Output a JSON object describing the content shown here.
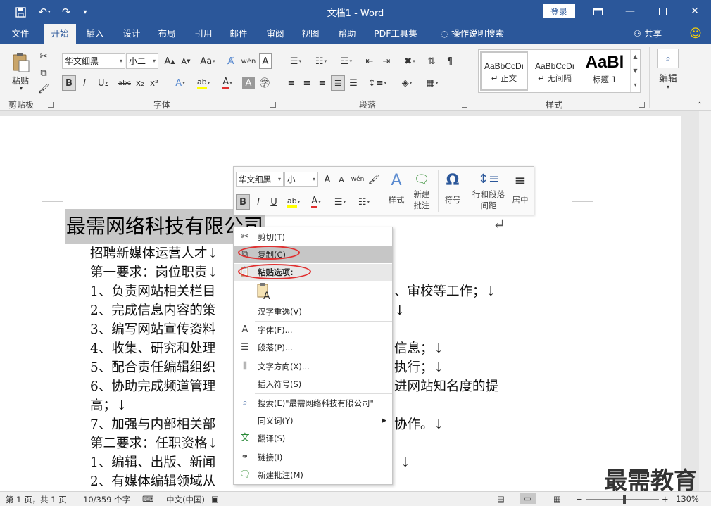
{
  "titlebar": {
    "title": "文档1 - Word",
    "login_label": "登录"
  },
  "menu": {
    "tabs": [
      "文件",
      "开始",
      "插入",
      "设计",
      "布局",
      "引用",
      "邮件",
      "审阅",
      "视图",
      "帮助",
      "PDF工具集"
    ],
    "tell_me": "操作说明搜索",
    "share": "共享"
  },
  "ribbon": {
    "font_name": "华文细黑",
    "font_size": "小二",
    "groups": {
      "clipboard": "剪贴板",
      "font": "字体",
      "paragraph": "段落",
      "styles": "样式",
      "editing": "编辑"
    },
    "paste_label": "粘贴",
    "styles": [
      {
        "preview": "AaBbCcDı",
        "name": "↵ 正文"
      },
      {
        "preview": "AaBbCcDı",
        "name": "↵ 无间隔"
      },
      {
        "preview": "AaBl",
        "name": "标题 1"
      }
    ],
    "editing_label": "编辑"
  },
  "document": {
    "title": "最需网络科技有限公司",
    "lines": [
      "招聘新媒体运营人才↓",
      "第一要求：岗位职责↓",
      "1、负责网站相关栏目",
      "2、完成信息内容的策",
      "3、编写网站宣传资料",
      "4、收集、研究和处理",
      "5、配合责任编辑组织",
      "6、协助完成频道管理",
      "高；↓",
      "7、加强与内部相关部",
      "第二要求：任职资格↓",
      "1、编辑、出版、新闻",
      "2、有媒体编辑领域从"
    ],
    "lines_right": [
      "、审校等工作；↓",
      "↓",
      "信息；↓",
      "执行；↓",
      "进网站知名度的提",
      "协作。↓",
      "↓"
    ],
    "return_mark": "↵"
  },
  "mini_toolbar": {
    "font_name": "华文细黑",
    "font_size": "小二",
    "styles_label": "样式",
    "new_comment_label": "新建批注",
    "symbol_label": "符号",
    "spacing_label": "行和段落间距",
    "center_label": "居中"
  },
  "context_menu": {
    "items": [
      {
        "label": "剪切(T)"
      },
      {
        "label": "复制(C)"
      },
      {
        "label": "粘贴选项:"
      },
      {
        "label": "汉字重选(V)"
      },
      {
        "label": "字体(F)..."
      },
      {
        "label": "段落(P)..."
      },
      {
        "label": "文字方向(X)..."
      },
      {
        "label": "插入符号(S)"
      },
      {
        "label": "搜索(E)\"最需网络科技有限公司\""
      },
      {
        "label": "同义词(Y)"
      },
      {
        "label": "翻译(S)"
      },
      {
        "label": "链接(I)"
      },
      {
        "label": "新建批注(M)"
      }
    ],
    "highlight_color": "#e03030"
  },
  "statusbar": {
    "page": "第 1 页，共 1 页",
    "words": "10/359 个字",
    "language": "中文(中国)",
    "zoom": "130%"
  },
  "watermark": "最需教育",
  "colors": {
    "brand": "#2b579a",
    "font_color_red": "#e03030",
    "highlight_yellow": "#ffff00"
  }
}
